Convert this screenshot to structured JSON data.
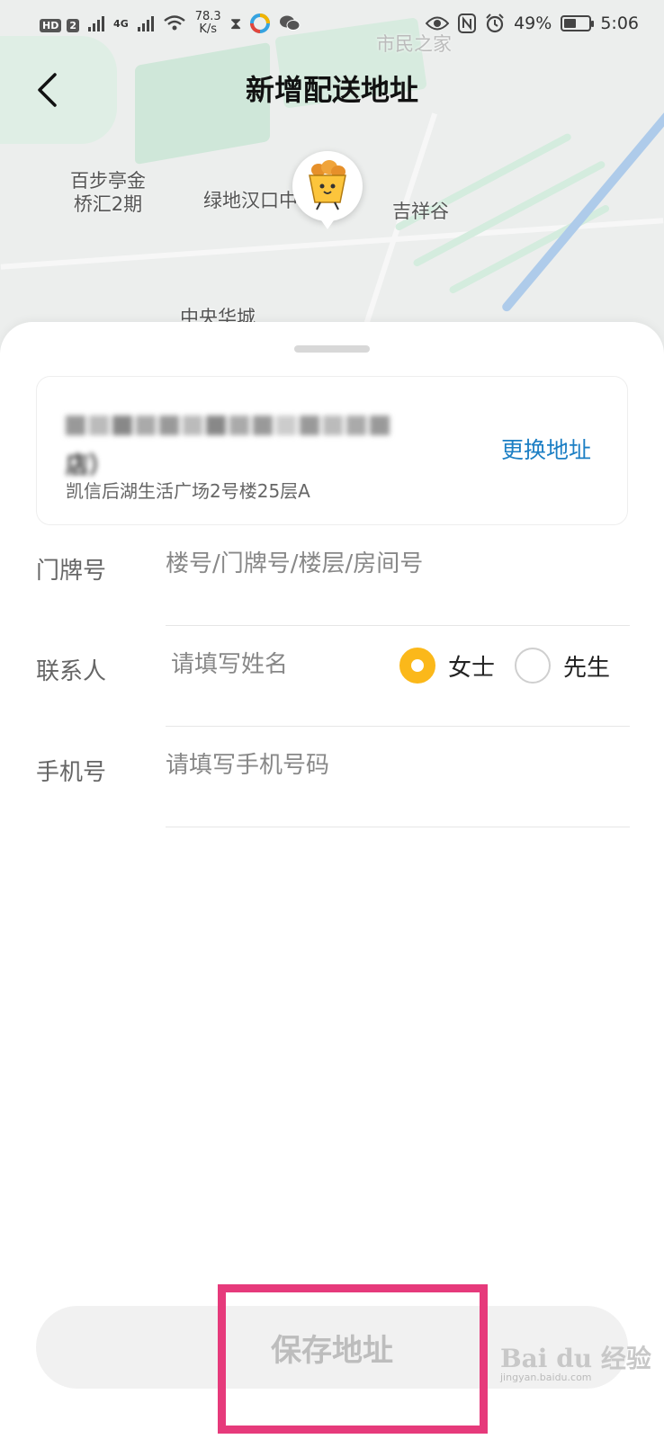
{
  "status_bar": {
    "hd_badge": "HD",
    "sim_badge": "2",
    "network_4g": "4G",
    "speed_value": "78.3",
    "speed_unit": "K/s",
    "battery_percent": "49%",
    "battery_level": 0.49,
    "time": "5:06"
  },
  "nav": {
    "title": "新增配送地址"
  },
  "map": {
    "labels": [
      "市民之家",
      "百步亭金\n桥汇2期",
      "绿地汉口中",
      "吉祥谷",
      "中央华城"
    ]
  },
  "address_card": {
    "name_blurred": "店）",
    "detail": "凯信后湖生活广场2号楼25层A",
    "change_label": "更换地址"
  },
  "form": {
    "doorplate": {
      "label": "门牌号",
      "placeholder": "楼号/门牌号/楼层/房间号"
    },
    "contact": {
      "label": "联系人",
      "placeholder": "请填写姓名"
    },
    "phone": {
      "label": "手机号",
      "placeholder": "请填写手机号码"
    },
    "gender": {
      "options": [
        "女士",
        "先生"
      ],
      "selected": "女士"
    }
  },
  "save_button": {
    "label": "保存地址"
  },
  "watermark": {
    "brand": "Bai du 经验",
    "url": "jingyan.baidu.com"
  },
  "colors": {
    "accent_yellow": "#fbb81a",
    "link_blue": "#1c7fc4",
    "highlight_pink": "#e63a7b"
  }
}
